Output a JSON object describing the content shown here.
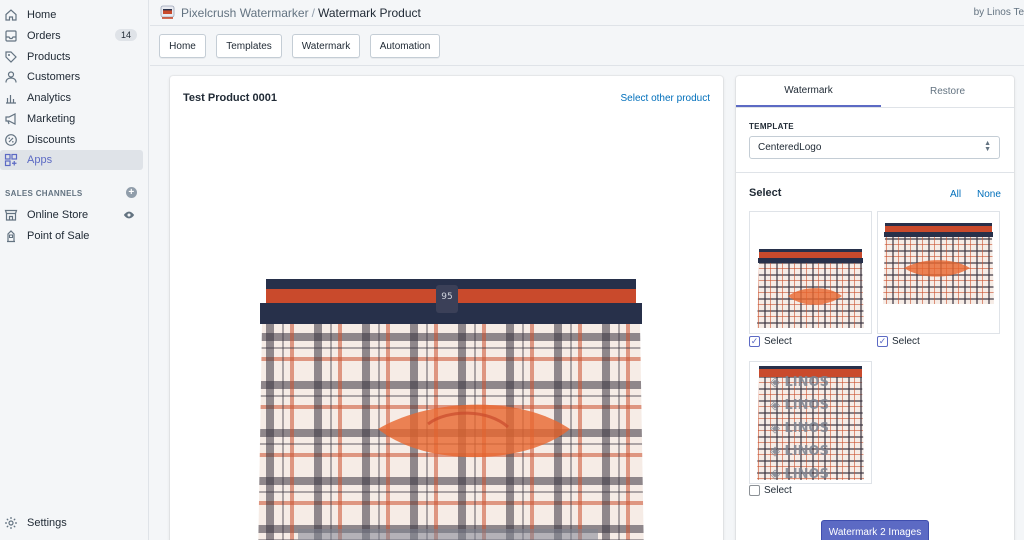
{
  "sidebar": {
    "items": [
      {
        "label": "Home",
        "icon": "home-icon"
      },
      {
        "label": "Orders",
        "icon": "orders-icon",
        "badge": "14"
      },
      {
        "label": "Products",
        "icon": "tag-icon"
      },
      {
        "label": "Customers",
        "icon": "person-icon"
      },
      {
        "label": "Analytics",
        "icon": "bar-chart-icon"
      },
      {
        "label": "Marketing",
        "icon": "megaphone-icon"
      },
      {
        "label": "Discounts",
        "icon": "discount-icon"
      },
      {
        "label": "Apps",
        "icon": "apps-icon",
        "active": true
      }
    ],
    "sales_channels_title": "SALES CHANNELS",
    "channels": [
      {
        "label": "Online Store",
        "icon": "store-icon"
      },
      {
        "label": "Point of Sale",
        "icon": "pos-icon"
      }
    ],
    "settings_label": "Settings"
  },
  "topbar": {
    "app_name": "Pixelcrush Watermarker",
    "separator": "/",
    "page": "Watermark Product",
    "byline": "by Linos Te"
  },
  "tabs": [
    "Home",
    "Templates",
    "Watermark",
    "Automation"
  ],
  "product": {
    "title": "Test Product 0001",
    "select_other": "Select other product"
  },
  "panel": {
    "tabs": {
      "watermark": "Watermark",
      "restore": "Restore"
    },
    "template_label": "TEMPLATE",
    "template_value": "CenteredLogo",
    "select_title": "Select",
    "all_link": "All",
    "none_link": "None",
    "checkbox_label": "Select",
    "thumbs": [
      {
        "checked": true
      },
      {
        "checked": true
      },
      {
        "checked": false,
        "overlay": "LINOS"
      }
    ],
    "action_button": "Watermark 2 Images"
  },
  "colors": {
    "accent": "#5c6ac4",
    "link": "#006fbb",
    "waistband_red": "#c94a2c",
    "waistband_navy": "#27304a"
  }
}
